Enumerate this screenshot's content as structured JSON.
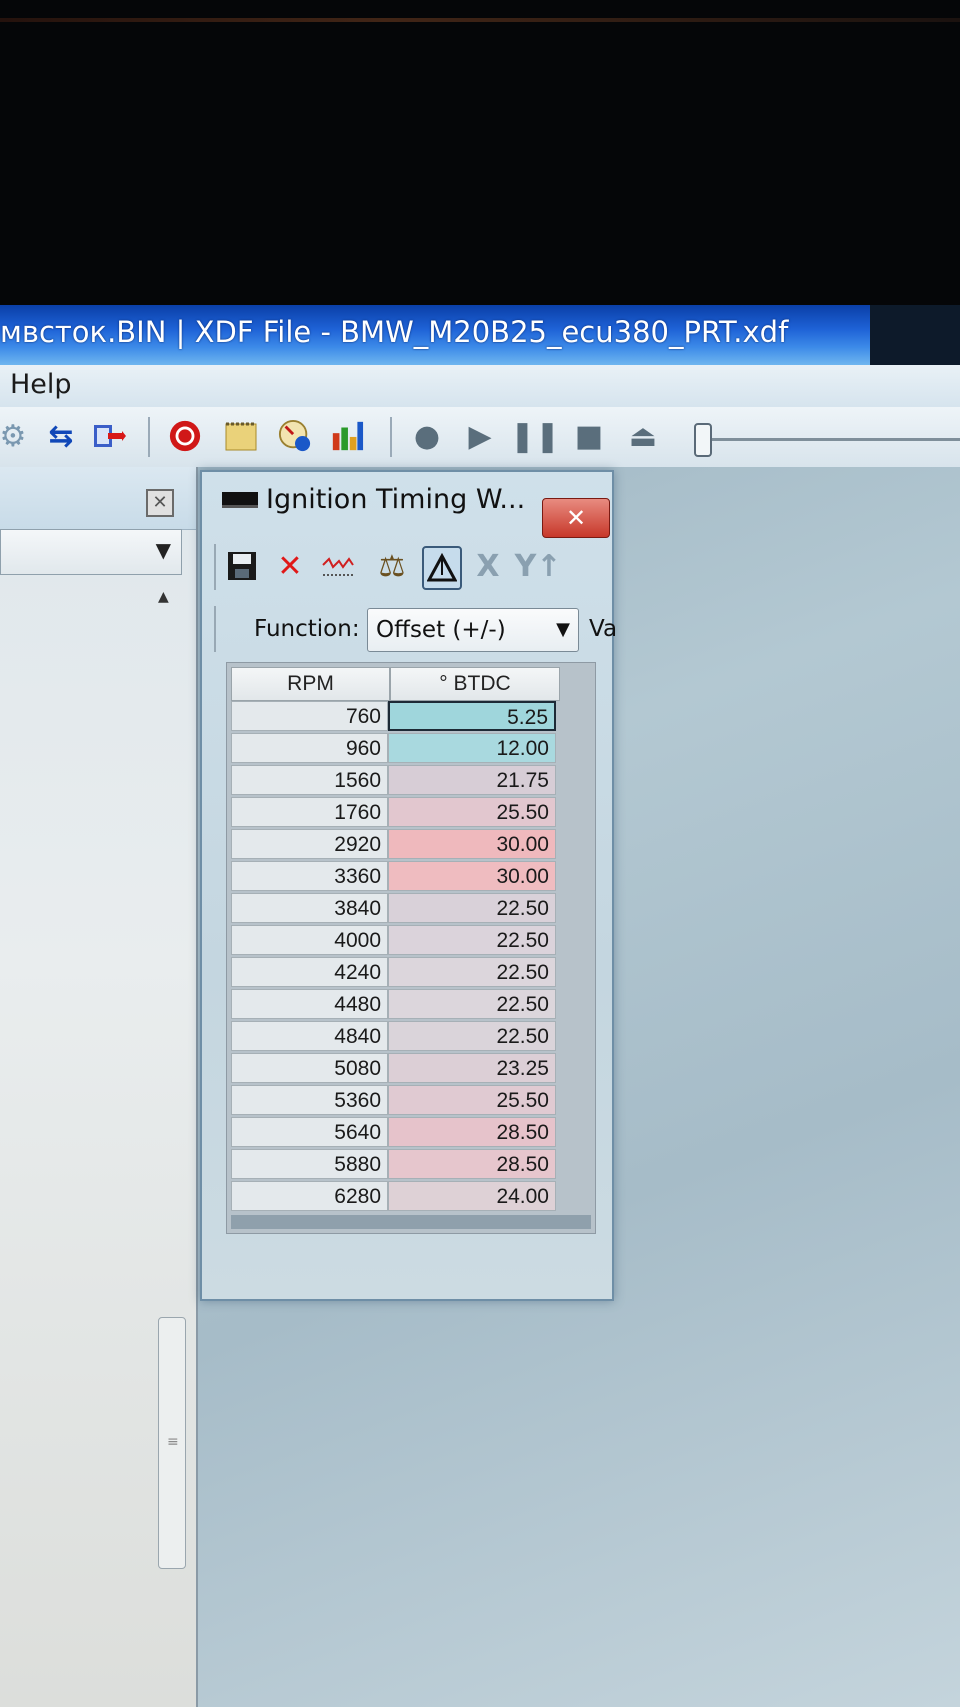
{
  "window": {
    "title": "мвсток.BIN | XDF File - BMW_M20B25_ecu380_PRT.xdf"
  },
  "menu": {
    "help": "Help"
  },
  "toolbar": {
    "icons": [
      "gear-icon",
      "swap-arrows-icon",
      "memory-import-icon",
      "stop-record-icon",
      "notepad-icon",
      "gauge-icon",
      "bar-chart-icon",
      "record-icon",
      "play-icon",
      "pause-icon",
      "stop-icon",
      "eject-icon"
    ]
  },
  "table_window": {
    "title": "Ignition Timing W...",
    "close_label": "✕",
    "function_label": "Function:",
    "function_value": "Offset (+/-)",
    "value_label_partial": "Va",
    "columns": {
      "rpm": "RPM",
      "btdc": "° BTDC"
    },
    "rows": [
      {
        "rpm": "760",
        "btdc": "5.25",
        "color": "#9fd6dc"
      },
      {
        "rpm": "960",
        "btdc": "12.00",
        "color": "#a9d9df"
      },
      {
        "rpm": "1560",
        "btdc": "21.75",
        "color": "#d7cdd6"
      },
      {
        "rpm": "1760",
        "btdc": "25.50",
        "color": "#e2c7cf"
      },
      {
        "rpm": "2920",
        "btdc": "30.00",
        "color": "#efb9bd"
      },
      {
        "rpm": "3360",
        "btdc": "30.00",
        "color": "#efbcc0"
      },
      {
        "rpm": "3840",
        "btdc": "22.50",
        "color": "#d9d1d9"
      },
      {
        "rpm": "4000",
        "btdc": "22.50",
        "color": "#dbd3db"
      },
      {
        "rpm": "4240",
        "btdc": "22.50",
        "color": "#dcd6dc"
      },
      {
        "rpm": "4480",
        "btdc": "22.50",
        "color": "#dcd6dc"
      },
      {
        "rpm": "4840",
        "btdc": "22.50",
        "color": "#dad4da"
      },
      {
        "rpm": "5080",
        "btdc": "23.25",
        "color": "#dccfd6"
      },
      {
        "rpm": "5360",
        "btdc": "25.50",
        "color": "#e0cad2"
      },
      {
        "rpm": "5640",
        "btdc": "28.50",
        "color": "#e6c3cb"
      },
      {
        "rpm": "5880",
        "btdc": "28.50",
        "color": "#e6c6cd"
      },
      {
        "rpm": "6280",
        "btdc": "24.00",
        "color": "#ded1d6"
      }
    ]
  },
  "colors": {
    "title_bar": "#1e62d6",
    "close_button": "#c7382a",
    "workspace": "#a6bcc8"
  }
}
